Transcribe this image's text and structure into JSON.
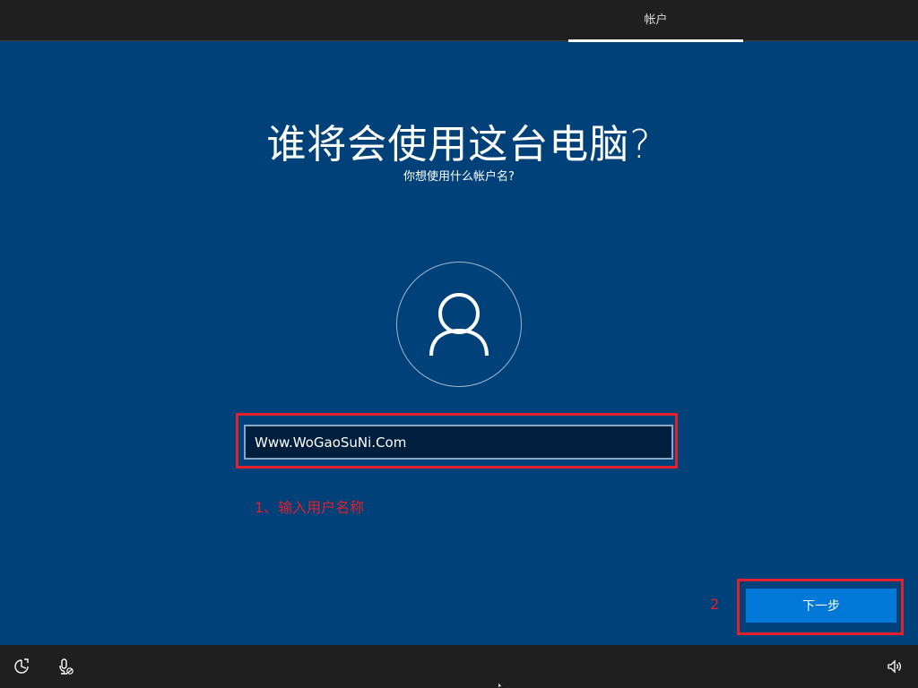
{
  "header": {
    "tab_label": "帐户"
  },
  "main": {
    "title": "谁将会使用这台电脑?",
    "subtitle": "你想使用什么帐户名?",
    "username_value": "Www.WoGaoSuNi.Com",
    "annotation_step1": "1、输入用户名称",
    "annotation_step2": "2",
    "next_button_label": "下一步"
  },
  "footer": {
    "icons": [
      "ease-of-access-icon",
      "microphone-off-icon",
      "volume-icon"
    ]
  },
  "colors": {
    "background": "#00417a",
    "bar": "#1f1f1f",
    "accent": "#0078d7",
    "annotation": "#e0202a"
  }
}
